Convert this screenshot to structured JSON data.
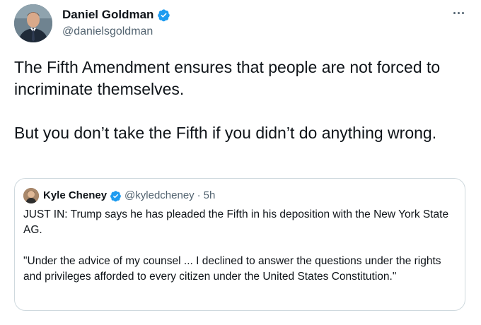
{
  "author": {
    "display_name": "Daniel Goldman",
    "handle": "@danielsgoldman",
    "verified": true,
    "avatar_icon": "person-in-suit-avatar"
  },
  "tweet": {
    "paragraphs": [
      "The Fifth Amendment ensures that people are not forced to incriminate themselves.",
      "But you don’t take the Fifth if you didn’t do anything wrong."
    ]
  },
  "more_icon": "ellipsis-icon",
  "quoted_tweet": {
    "display_name": "Kyle Cheney",
    "handle": "@kyledcheney",
    "separator": "·",
    "time": "5h",
    "verified": true,
    "paragraphs": [
      "JUST IN: Trump says he has pleaded the Fifth in his deposition with the New York State AG.",
      "\"Under the advice of my counsel ... I declined to answer the questions under the rights and privileges afforded to every citizen under the United States Constitution.\""
    ]
  },
  "colors": {
    "text": "#0f1419",
    "secondary": "#536471",
    "verified_blue": "#1d9bf0",
    "border": "#cfd9de"
  }
}
